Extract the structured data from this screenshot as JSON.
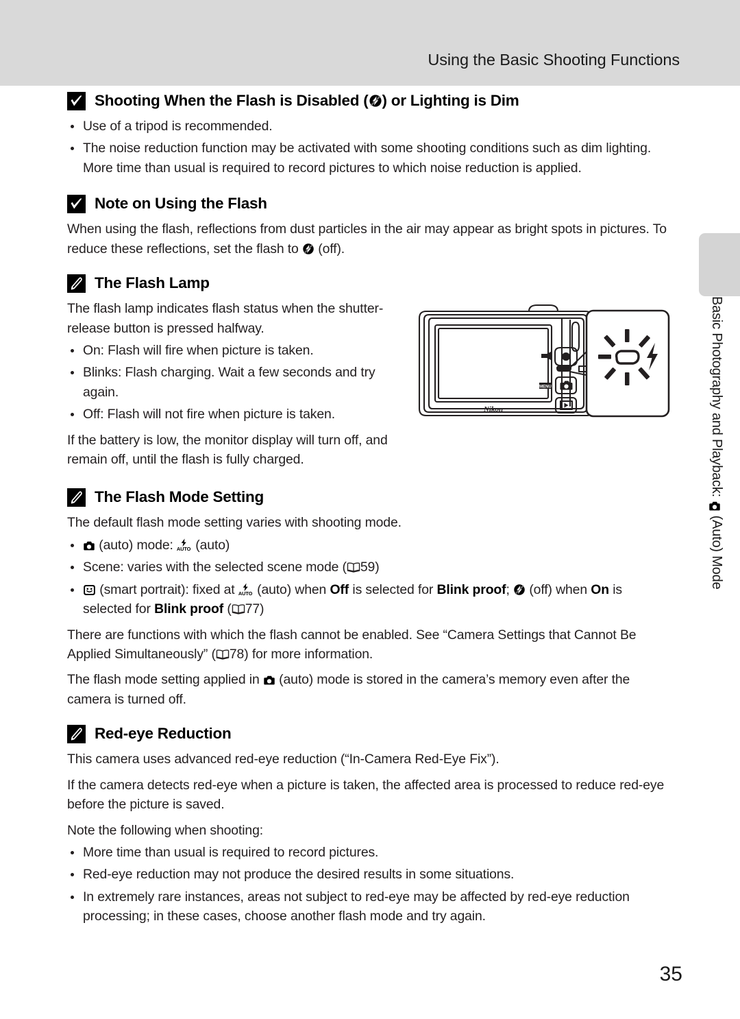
{
  "header": {
    "title": "Using the Basic Shooting Functions"
  },
  "sections": [
    {
      "id": "flash-disabled",
      "icon": "check-mark-icon",
      "title_pre": "Shooting When the Flash is Disabled (",
      "title_icon": "flash-off-icon",
      "title_post": ") or Lighting is Dim",
      "bullets": [
        "Use of a tripod is recommended.",
        "The noise reduction function may be activated with some shooting conditions such as dim lighting. More time than usual is required to record pictures to which noise reduction is applied."
      ]
    },
    {
      "id": "note-using-flash",
      "icon": "check-mark-icon",
      "title": "Note on Using the Flash",
      "para_pre": "When using the flash, reflections from dust particles in the air may appear as bright spots in pictures. To reduce these reflections, set the flash to ",
      "para_icon": "flash-off-icon",
      "para_post": " (off)."
    },
    {
      "id": "flash-lamp",
      "icon": "pencil-note-icon",
      "title": "The Flash Lamp",
      "intro": "The flash lamp indicates flash status when the shutter-release button is pressed halfway.",
      "bullets": [
        "On: Flash will fire when picture is taken.",
        "Blinks: Flash charging. Wait a few seconds and try again.",
        "Off: Flash will not fire when picture is taken."
      ],
      "outro": "If the battery is low, the monitor display will turn off, and remain off, until the flash is fully charged.",
      "figure": {
        "name": "camera-back-flash-lamp-illustration",
        "brand_label": "Nikon",
        "menu_label": "MENU",
        "callout": "flash-lamp-blinking-callout"
      }
    },
    {
      "id": "flash-mode-setting",
      "icon": "pencil-note-icon",
      "title": "The Flash Mode Setting",
      "intro": "The default flash mode setting varies with shooting mode.",
      "bullet1": {
        "icon": "camera-auto-icon",
        "text_a": " (auto) mode: ",
        "icon2": "flash-auto-icon",
        "text_b": " (auto)"
      },
      "bullet2": {
        "text_a": "Scene: varies with the selected scene mode (",
        "icon": "book-reference-icon",
        "page": "59",
        "text_b": ")"
      },
      "bullet3": {
        "icon": "smart-portrait-icon",
        "text_a": " (smart portrait): fixed at ",
        "icon2": "flash-auto-icon",
        "text_b": " (auto) when ",
        "bold_a": "Off",
        "text_c": " is selected for ",
        "bold_b": "Blink proof",
        "text_d": "; ",
        "icon3": "flash-off-icon",
        "text_e": " (off) when ",
        "bold_c": "On",
        "text_f": " is selected for ",
        "bold_d": "Blink proof",
        "text_g": " (",
        "icon4": "book-reference-icon",
        "page": "77",
        "text_h": ")"
      },
      "para_functions_a": "There are functions with which the flash cannot be enabled. See “Camera Settings that Cannot Be Applied Simultaneously” (",
      "para_functions_page": "78",
      "para_functions_b": ") for more information.",
      "para_stored_a": "The flash mode setting applied in ",
      "para_stored_icon": "camera-auto-icon",
      "para_stored_b": " (auto) mode is stored in the camera’s memory even after the camera is turned off."
    },
    {
      "id": "red-eye-reduction",
      "icon": "pencil-note-icon",
      "title": "Red-eye Reduction",
      "para1": "This camera uses advanced red-eye reduction (“In-Camera Red-Eye Fix”).",
      "para2": "If the camera detects red-eye when a picture is taken, the affected area is processed to reduce red-eye before the picture is saved.",
      "para3": "Note the following when shooting:",
      "bullets": [
        "More time than usual is required to record pictures.",
        "Red-eye reduction may not produce the desired results in some situations.",
        "In extremely rare instances, areas not subject to red-eye may be affected by red-eye reduction processing; in these cases, choose another flash mode and try again."
      ]
    }
  ],
  "side_tab": {
    "text_a": "Basic Photography and Playback: ",
    "icon": "camera-auto-icon",
    "text_b": " (Auto) Mode"
  },
  "footer": {
    "page_number": "35"
  },
  "colors": {
    "header_band": "#d9d9d9",
    "side_tab": "#d4d4d4",
    "text": "#231f20",
    "ink": "#000000"
  }
}
